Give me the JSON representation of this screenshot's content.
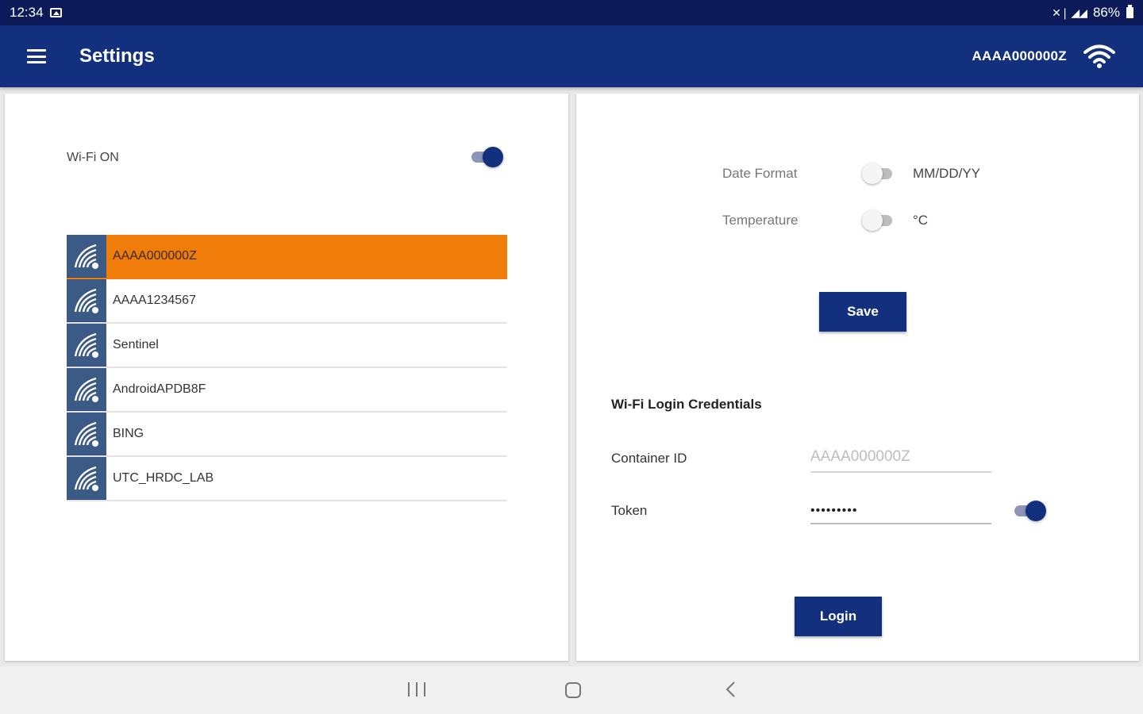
{
  "status_bar": {
    "time": "12:34",
    "signal_glyphs": "✕❘ ◢◢",
    "battery": "86%"
  },
  "app_bar": {
    "title": "Settings",
    "connected_ssid": "AAAA000000Z"
  },
  "wifi": {
    "label": "Wi-Fi ON",
    "enabled": true
  },
  "networks": [
    {
      "ssid": "AAAA000000Z",
      "selected": true
    },
    {
      "ssid": "AAAA1234567",
      "selected": false
    },
    {
      "ssid": "Sentinel",
      "selected": false
    },
    {
      "ssid": "AndroidAPDB8F",
      "selected": false
    },
    {
      "ssid": "BING",
      "selected": false
    },
    {
      "ssid": "UTC_HRDC_LAB",
      "selected": false
    }
  ],
  "preferences": {
    "date_format": {
      "label": "Date Format",
      "value": "MM/DD/YY",
      "enabled": false
    },
    "temperature": {
      "label": "Temperature",
      "value": "°C",
      "enabled": false
    },
    "save_label": "Save"
  },
  "credentials": {
    "title": "Wi-Fi Login Credentials",
    "container_id": {
      "label": "Container ID",
      "value": "AAAA000000Z"
    },
    "token": {
      "label": "Token",
      "value": "•••••••••",
      "show_enabled": true
    },
    "login_label": "Login"
  },
  "colors": {
    "status_bar": "#0c1a5a",
    "app_bar": "#12307d",
    "selected_network": "#f07d0a",
    "network_icon_bg": "#3c5a86",
    "button": "#12307d"
  }
}
